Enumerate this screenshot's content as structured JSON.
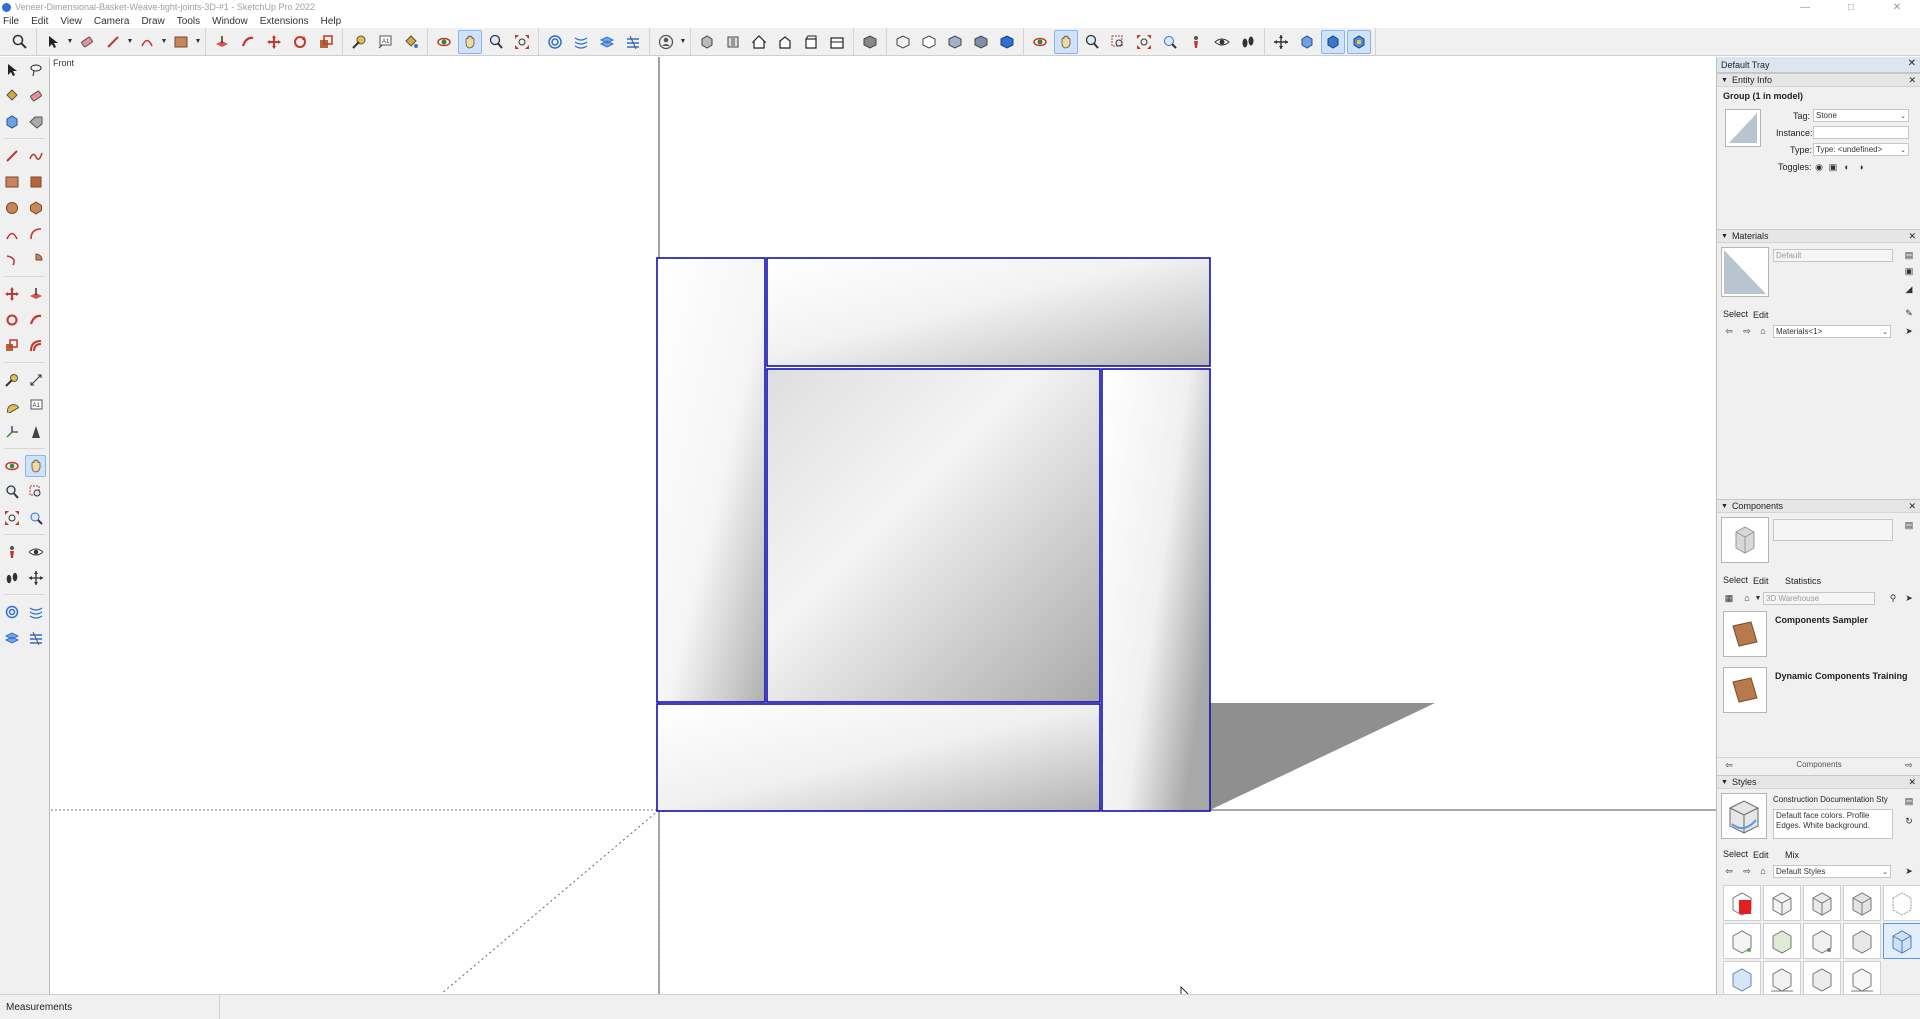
{
  "window": {
    "title": "Veneer-Dimensional-Basket-Weave-tight-joints-3D-#1 - SketchUp Pro 2022",
    "minimize_icon": "minimize-icon",
    "maximize_icon": "maximize-icon",
    "close_icon": "close-icon"
  },
  "menu": [
    "File",
    "Edit",
    "View",
    "Camera",
    "Draw",
    "Tools",
    "Window",
    "Extensions",
    "Help"
  ],
  "viewport": {
    "scene_label": "Front"
  },
  "tray": {
    "title": "Default Tray",
    "entity_info": {
      "header": "Entity Info",
      "selection": "Group (1 in model)",
      "tag_label": "Tag:",
      "tag_value": "Stone",
      "instance_label": "Instance:",
      "instance_value": "",
      "type_label": "Type:",
      "type_value": "Type: <undefined>",
      "toggles_label": "Toggles:"
    },
    "materials": {
      "header": "Materials",
      "name_value": "Default",
      "select_tab": "Select",
      "edit_tab": "Edit",
      "library_value": "Materials<1>"
    },
    "components": {
      "header": "Components",
      "select_tab": "Select",
      "edit_tab": "Edit",
      "statistics_tab": "Statistics",
      "search_placeholder": "3D Warehouse",
      "items": [
        {
          "name": "Components Sampler"
        },
        {
          "name": "Dynamic Components Training"
        }
      ],
      "footer": "Components"
    },
    "styles": {
      "header": "Styles",
      "style_name": "Construction Documentation Sty",
      "style_desc": "Default face colors. Profile Edges. White background.",
      "select_tab": "Select",
      "edit_tab": "Edit",
      "mix_tab": "Mix",
      "library_value": "Default Styles"
    }
  },
  "status": {
    "measurements_label": "Measurements"
  },
  "colors": {
    "selection_blue": "#1010b0",
    "shadow": "#8f8f8f",
    "accent": "#cfe3f8"
  }
}
